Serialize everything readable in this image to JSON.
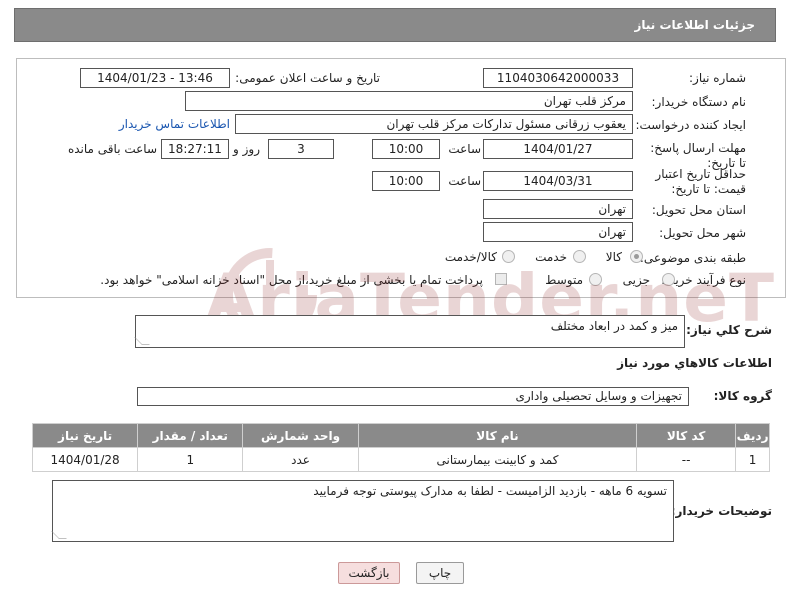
{
  "header": {
    "title": "جزئیات اطلاعات نیاز"
  },
  "form": {
    "need_number_label": "شماره نیاز:",
    "need_number": "1104030642000033",
    "announce_label": "تاریخ و ساعت اعلان عمومی:",
    "announce_value": "1404/01/23 - 13:46",
    "buyer_org_label": "نام دستگاه خریدار:",
    "buyer_org": "مرکز قلب تهران",
    "creator_label": "ایجاد کننده درخواست:",
    "creator": "یعقوب زرقانی مسئول تدارکات مرکز قلب تهران",
    "contact_link": "اطلاعات تماس خریدار",
    "reply_deadline_label": "مهلت ارسال پاسخ: تا تاریخ:",
    "reply_date": "1404/01/27",
    "time_label": "ساعت",
    "reply_time": "10:00",
    "days_value": "3",
    "days_label": "روز و",
    "remaining_time": "18:27:11",
    "remaining_label": "ساعت باقی مانده",
    "price_validity_label": "حداقل تاریخ اعتبار قیمت: تا تاریخ:",
    "price_date": "1404/03/31",
    "price_time": "10:00",
    "province_label": "استان محل تحویل:",
    "province": "تهران",
    "city_label": "شهر محل تحویل:",
    "city": "تهران",
    "category_label": "طبقه بندی موضوعی:",
    "category_options": [
      "کالا",
      "خدمت",
      "کالا/خدمت"
    ],
    "category_selected": "کالا",
    "process_label": "نوع فرآیند خرید :",
    "process_options": [
      "جزیی",
      "متوسط"
    ],
    "payment_note": "پرداخت تمام یا بخشی از مبلغ خرید،از محل \"اسناد خزانه اسلامی\" خواهد بود."
  },
  "watermark": {
    "text": "AriaTender.neT"
  },
  "summary": {
    "label": "شرح کلي نياز:",
    "value": "میز و کمد در ابعاد مختلف"
  },
  "goods_section": {
    "title": "اطلاعات کالاهاي مورد نياز",
    "group_label": "گروه کالا:",
    "group_value": "تجهیزات و وسایل تحصیلی واداری",
    "columns": [
      "ردیف",
      "کد کالا",
      "نام کالا",
      "واحد شمارش",
      "تعداد / مقدار",
      "تاریخ نیاز"
    ],
    "rows": [
      [
        "1",
        "--",
        "کمد و کابینت بیمارستانی",
        "عدد",
        "1",
        "1404/01/28"
      ]
    ]
  },
  "buyer_notes": {
    "label": "توضیحات خریدار:",
    "value": "تسویه 6 ماهه - بازدید الزامیست - لطفا به مدارک پیوستی توجه فرمایید"
  },
  "buttons": {
    "print": "چاپ",
    "back": "بازگشت"
  },
  "colors": {
    "header_bg": "#8a8a8a",
    "link": "#1a56b0",
    "back_button_bg": "#f6dede"
  }
}
